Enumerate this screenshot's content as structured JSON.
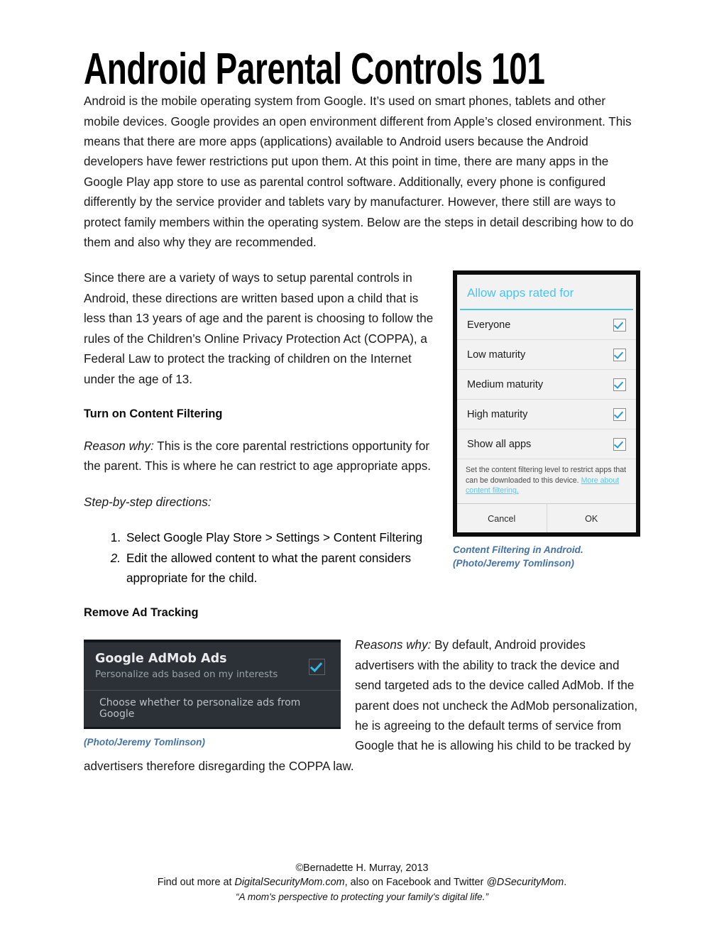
{
  "document": {
    "title": "Android Parental Controls 101",
    "paragraphs": {
      "intro": "Android is the mobile operating system from Google. It’s used on smart phones, tablets and other mobile devices. Google provides an open environment different from Apple’s closed environment. This means that there are more apps (applications) available to Android users because the Android developers have fewer restrictions put upon them.  At this point in time, there are many apps in the Google Play app store to use as parental control software. Additionally, every phone is configured differently by the service provider and tablets vary by manufacturer. However, there still are ways to protect family members within the operating system. Below are the steps in detail describing how to do them and also why they are recommended.",
      "coppa": "Since there are a variety of ways to setup parental controls in Android, these directions are written based upon a child that is less than 13 years of age and the parent is choosing to follow the rules of the Children’s Online Privacy Protection Act (COPPA), a Federal Law to protect the tracking of children on the Internet under the age of 13."
    },
    "sections": [
      {
        "heading": "Turn on Content Filtering",
        "reason_label": "Reason why:",
        "reason_text": " This is the core parental restrictions opportunity for the parent. This is where he can restrict to age appropriate apps.",
        "directions_label": "Step-by-step directions:",
        "steps": [
          {
            "marker": "1.",
            "text": "Select Google Play Store > Settings > Content Filtering",
            "marker_italic": false
          },
          {
            "marker": "2.",
            "text": "Edit the allowed content to what the parent considers appropriate for the child.",
            "marker_italic": true
          }
        ]
      },
      {
        "heading": "Remove Ad Tracking",
        "reason_label": "Reasons why:",
        "reason_text": " By default, Android provides advertisers with the ability to track the device and send targeted ads to the device called AdMob.  If the parent does not uncheck the AdMob personalization, he is agreeing to the default terms of service from Google that he is allowing his child to be tracked by advertisers therefore disregarding the COPPA law."
      }
    ]
  },
  "content_filter_dialog": {
    "title": "Allow apps rated for",
    "rows": [
      {
        "label": "Everyone",
        "checked": true
      },
      {
        "label": "Low maturity",
        "checked": true
      },
      {
        "label": "Medium maturity",
        "checked": true
      },
      {
        "label": "High maturity",
        "checked": true
      },
      {
        "label": "Show all apps",
        "checked": true
      }
    ],
    "note_text": "Set the content filtering level to restrict apps that can be downloaded to this device. ",
    "note_link": "More about content filtering.",
    "cancel_label": "Cancel",
    "ok_label": "OK",
    "caption_line1": "Content Filtering in Android.",
    "caption_line2": "(Photo/Jeremy Tomlinson)"
  },
  "admob_screenshot": {
    "title": "Google AdMob Ads",
    "subtitle": "Personalize ads based on my interests",
    "checked": true,
    "footer_text": "Choose whether to personalize ads from Google",
    "caption": "(Photo/Jeremy Tomlinson)"
  },
  "footer": {
    "line1": "©Bernadette H. Murray, 2013",
    "line2_pre": "Find out more at ",
    "line2_site": "DigitalSecurityMom.com",
    "line2_mid": ", also on Facebook and Twitter ",
    "line2_handle": "@DSecurityMom",
    "line2_post": ".",
    "line3": "“A mom's perspective to protecting your family's digital life.”"
  },
  "colors": {
    "caption_blue": "#4472a8",
    "android_accent": "#4cc2f1",
    "admob_accent": "#33b5e5",
    "dark_bg": "#2b3137"
  }
}
